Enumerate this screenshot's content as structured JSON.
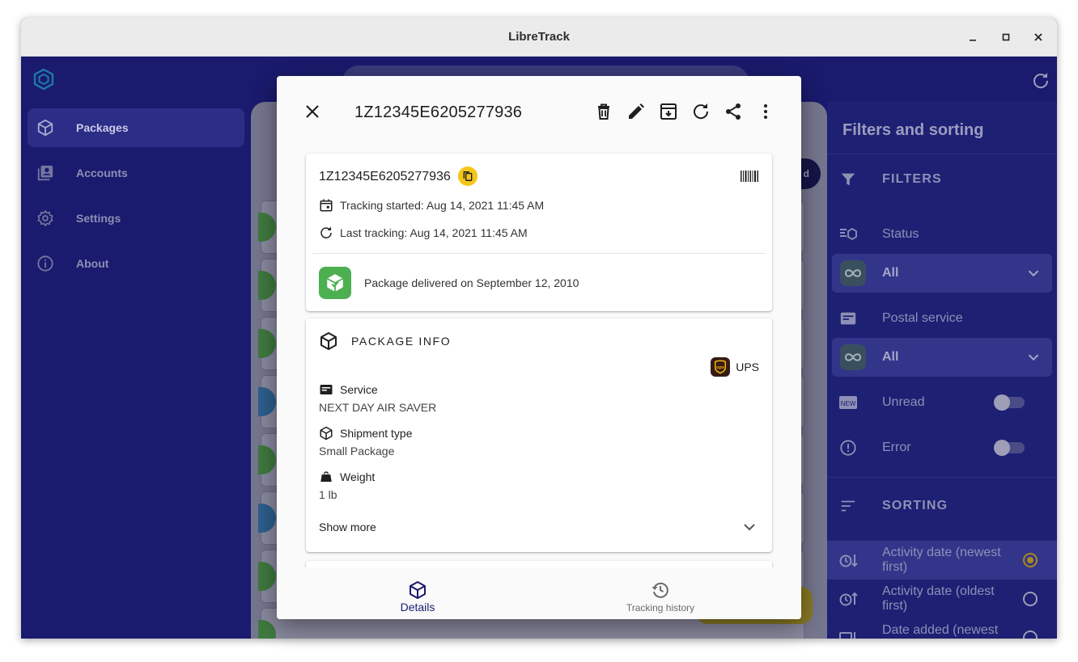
{
  "window": {
    "title": "LibreTrack"
  },
  "sidebar": {
    "items": [
      {
        "label": "Packages",
        "icon": "package-icon",
        "active": true
      },
      {
        "label": "Accounts",
        "icon": "accounts-icon",
        "active": false
      },
      {
        "label": "Settings",
        "icon": "gear-icon",
        "active": false
      },
      {
        "label": "About",
        "icon": "info-icon",
        "active": false
      }
    ]
  },
  "background": {
    "fab_label_fragment": "d"
  },
  "filters_panel": {
    "title": "Filters and sorting",
    "filters_header": "FILTERS",
    "status_label": "Status",
    "status_value": "All",
    "postal_label": "Postal service",
    "postal_value": "All",
    "unread_label": "Unread",
    "error_label": "Error",
    "sorting_header": "SORTING",
    "sort_options": [
      {
        "label": "Activity date (newest first)",
        "selected": true
      },
      {
        "label": "Activity date (oldest first)",
        "selected": false
      },
      {
        "label": "Date added (newest",
        "selected": false
      }
    ]
  },
  "dialog": {
    "title": "1Z12345E6205277936",
    "tracking_card": {
      "tracking_number": "1Z12345E6205277936",
      "tracking_started": "Tracking started: Aug 14, 2021 11:45 AM",
      "last_tracking": "Last tracking: Aug 14, 2021 11:45 AM",
      "delivery_status": "Package delivered on September 12, 2010"
    },
    "package_info": {
      "header": "PACKAGE INFO",
      "carrier": "UPS",
      "service_label": "Service",
      "service_value": "NEXT DAY AIR SAVER",
      "shipment_type_label": "Shipment type",
      "shipment_type_value": "Small Package",
      "weight_label": "Weight",
      "weight_value": "1 lb",
      "show_more": "Show more"
    },
    "bottom_nav": {
      "details": "Details",
      "tracking_history": "Tracking history"
    }
  },
  "colors": {
    "app_background": "#1a1a6e",
    "accent_yellow": "#f5c518",
    "delivered_green": "#4caf50",
    "ups_brown": "#351c15",
    "active_nav": "#1a1a6e"
  }
}
